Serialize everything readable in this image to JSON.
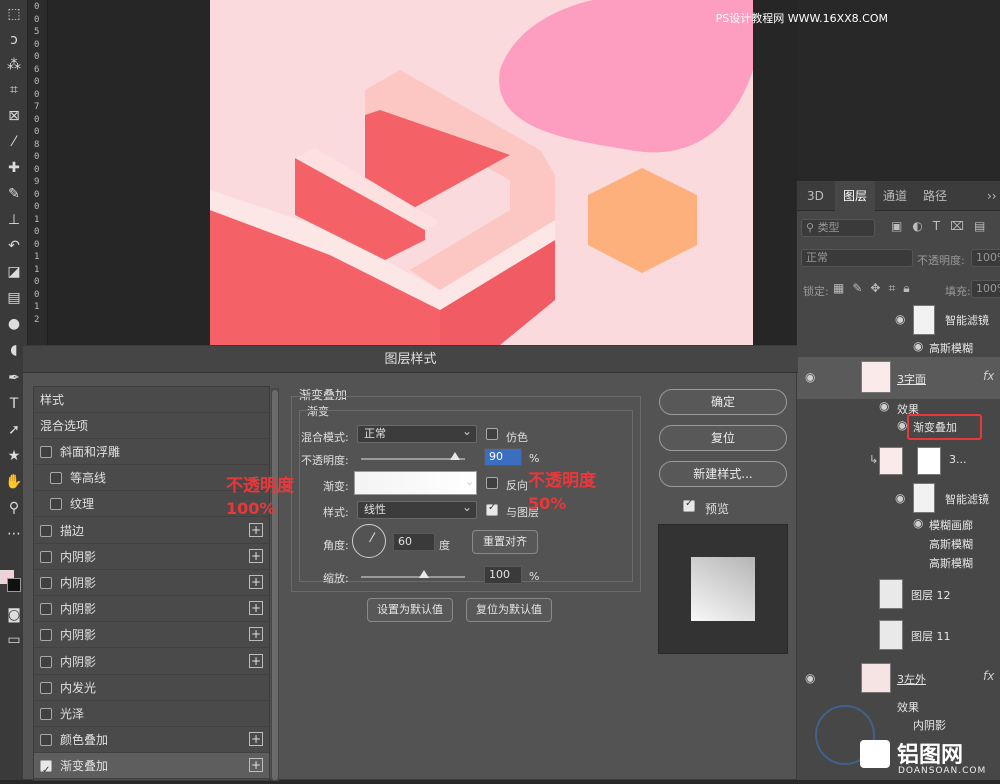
{
  "watermark_top": "PS设计教程网 WWW.16XX8.COM",
  "ruler_numbers": [
    "0",
    "0",
    "5",
    "0",
    "0",
    "6",
    "0",
    "0",
    "7",
    "0",
    "0",
    "8",
    "0",
    "0",
    "9",
    "0",
    "0",
    "1",
    "0",
    "0",
    "1",
    "1",
    "0",
    "0",
    "1",
    "2"
  ],
  "layers_panel": {
    "tabs": [
      "3D",
      "图层",
      "通道",
      "路径"
    ],
    "expand": "››",
    "kind_placeholder": "类型",
    "blend_mode": "正常",
    "opacity_label": "不透明度:",
    "opacity_value": "100%",
    "lock_label": "锁定:",
    "fill_label": "填充:",
    "fill_value": "100%",
    "items": [
      {
        "name": "智能滤镜"
      },
      {
        "name": "高斯模糊"
      },
      {
        "name": "3字面",
        "fx": "fx"
      },
      {
        "name": "效果"
      },
      {
        "name": "渐变叠加"
      },
      {
        "name": "3..."
      },
      {
        "name": "智能滤镜"
      },
      {
        "name": "模糊画廊"
      },
      {
        "name": "高斯模糊"
      },
      {
        "name": "高斯模糊"
      },
      {
        "name": "图层 12"
      },
      {
        "name": "图层 11"
      },
      {
        "name": "3左外",
        "fx": "fx"
      },
      {
        "name": "效果"
      },
      {
        "name": "内阴影"
      }
    ]
  },
  "dialog": {
    "title": "图层样式",
    "styles_header": "样式",
    "blend_options": "混合选项",
    "style_items": [
      {
        "label": "斜面和浮雕",
        "checked": false,
        "plus": false,
        "indent": false
      },
      {
        "label": "等高线",
        "checked": false,
        "plus": false,
        "indent": true
      },
      {
        "label": "纹理",
        "checked": false,
        "plus": false,
        "indent": true
      },
      {
        "label": "描边",
        "checked": false,
        "plus": true,
        "indent": false
      },
      {
        "label": "内阴影",
        "checked": false,
        "plus": true,
        "indent": false
      },
      {
        "label": "内阴影",
        "checked": false,
        "plus": true,
        "indent": false
      },
      {
        "label": "内阴影",
        "checked": false,
        "plus": true,
        "indent": false
      },
      {
        "label": "内阴影",
        "checked": false,
        "plus": true,
        "indent": false
      },
      {
        "label": "内阴影",
        "checked": false,
        "plus": true,
        "indent": false
      },
      {
        "label": "内发光",
        "checked": false,
        "plus": false,
        "indent": false
      },
      {
        "label": "光泽",
        "checked": false,
        "plus": false,
        "indent": false
      },
      {
        "label": "颜色叠加",
        "checked": false,
        "plus": true,
        "indent": false
      },
      {
        "label": "渐变叠加",
        "checked": true,
        "plus": true,
        "indent": false
      }
    ],
    "section_title": "渐变叠加",
    "sub_title": "渐变",
    "blend_mode_label": "混合模式:",
    "blend_mode_value": "正常",
    "dither_label": "仿色",
    "opacity_label": "不透明度:",
    "opacity_value": "90",
    "opacity_unit": "%",
    "gradient_label": "渐变:",
    "reverse_label": "反向",
    "style_label": "样式:",
    "style_value": "线性",
    "align_label": "与图层",
    "angle_label": "角度:",
    "angle_value": "60",
    "angle_unit": "度",
    "reset_align": "重置对齐",
    "scale_label": "缩放:",
    "scale_value": "100",
    "scale_unit": "%",
    "set_default": "设置为默认值",
    "reset_default": "复位为默认值",
    "ok": "确定",
    "reset": "复位",
    "new_style": "新建样式...",
    "preview_label": "预览"
  },
  "annotations": {
    "left_line1": "不透明度",
    "left_line2": "100%",
    "right_line1": "不透明度",
    "right_line2": "50%"
  },
  "watermark_bottom": {
    "logo_text": "铝图网",
    "domain": "DOANSOAN.COM"
  },
  "colors": {
    "artboard_bg": "#fadadd",
    "pink_blob": "#fd9ec0",
    "hexagon": "#fdb07c",
    "number_red": "#f46268",
    "annotation_red": "#e8383a"
  }
}
